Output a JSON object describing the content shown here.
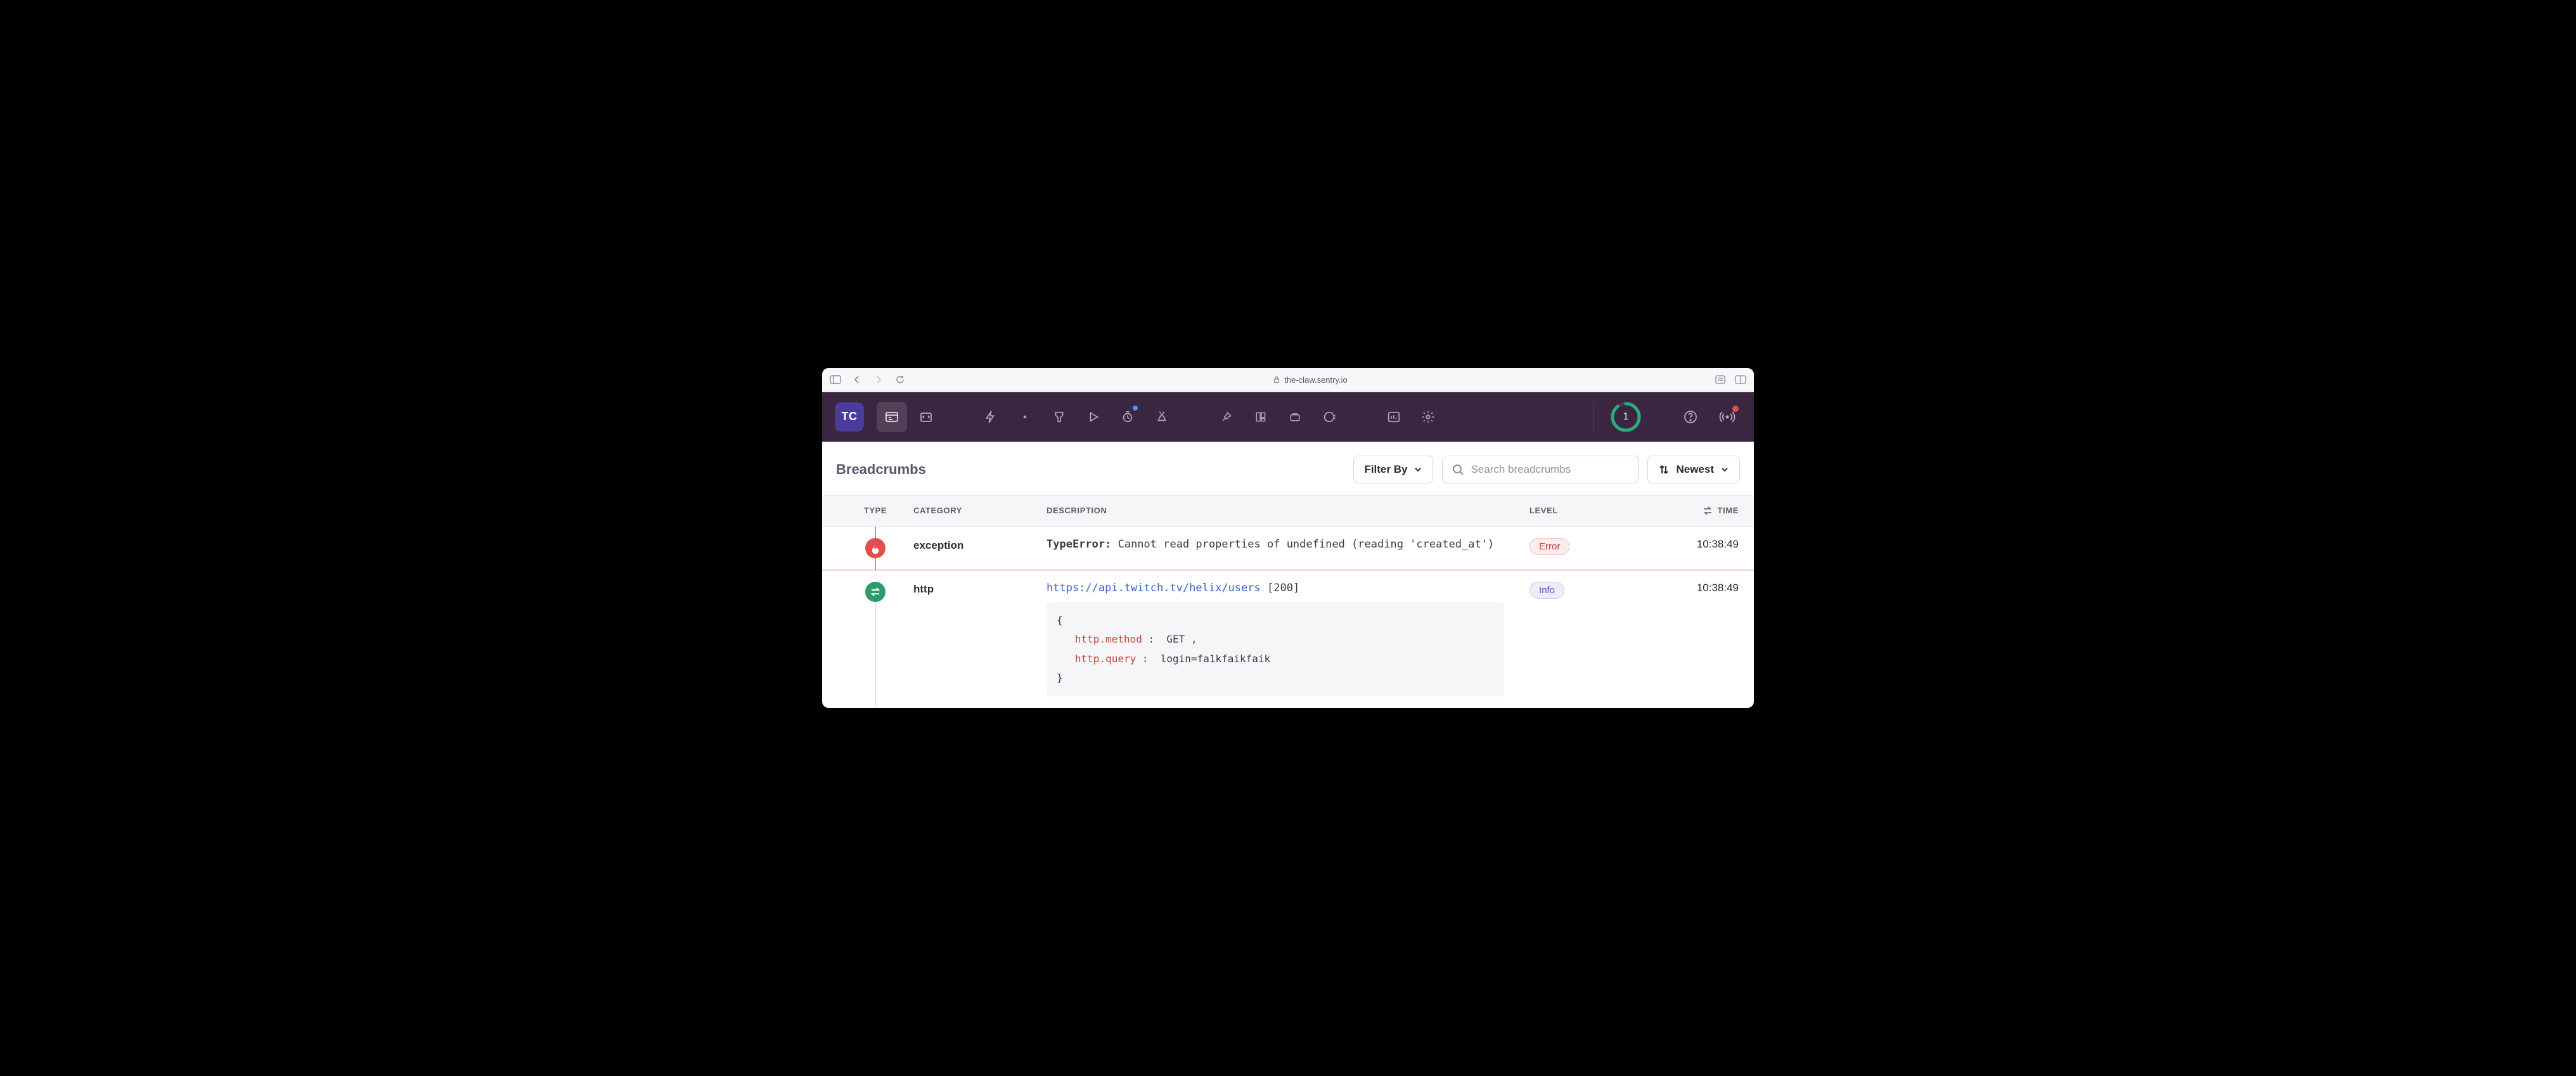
{
  "browser": {
    "url": "the-claw.sentry.io"
  },
  "org_badge": "TC",
  "quota_count": "1",
  "section_title": "Breadcrumbs",
  "filter_label": "Filter By",
  "search_placeholder": "Search breadcrumbs",
  "sort_label": "Newest",
  "columns": {
    "type": "TYPE",
    "category": "CATEGORY",
    "description": "DESCRIPTION",
    "level": "LEVEL",
    "time": "TIME"
  },
  "rows": [
    {
      "category": "exception",
      "err_type": "TypeError:",
      "err_msg": " Cannot read properties of undefined (reading 'created_at')",
      "level": "Error",
      "time": "10:38:49"
    },
    {
      "category": "http",
      "url": "https://api.twitch.tv/helix/users",
      "status": " [200]",
      "code_open": "{",
      "kv": [
        {
          "k": "http.method",
          "sep": " :  ",
          "v": "GET",
          "trail": " ,"
        },
        {
          "k": "http.query",
          "sep": " :  ",
          "v": "login=fa1kfaikfaik",
          "trail": ""
        }
      ],
      "code_close": "}",
      "level": "Info",
      "time": "10:38:49"
    }
  ]
}
